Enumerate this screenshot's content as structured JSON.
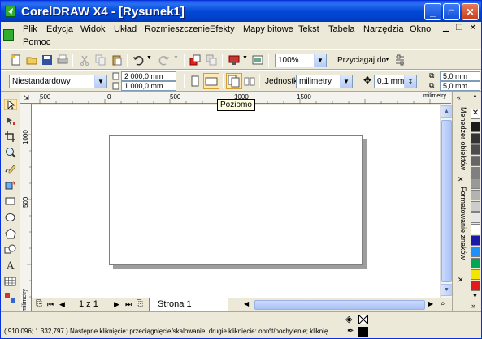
{
  "window": {
    "title": "CorelDRAW X4 - [Rysunek1]"
  },
  "menu": {
    "items": [
      "Plik",
      "Edycja",
      "Widok",
      "Układ",
      "Rozmieszczenie",
      "Efekty",
      "Mapy bitowe",
      "Tekst",
      "Tabela",
      "Narzędzia",
      "Okno",
      "Pomoc"
    ]
  },
  "standard_toolbar": {
    "zoom": "100%",
    "snap": "Przyciągaj do"
  },
  "property_bar": {
    "preset": "Niestandardowy",
    "width": "2 000,0 mm",
    "height": "1 000,0 mm",
    "units_label": "Jednostki:",
    "units": "milimetry",
    "nudge": "0,1 mm",
    "dup_x": "5,0 mm",
    "dup_y": "5,0 mm"
  },
  "tooltip": "Poziomo",
  "ruler": {
    "h_labels": [
      "500",
      "0",
      "500",
      "1000",
      "1500"
    ],
    "h_unit": "milimetry",
    "v_labels": [
      "1000",
      "500"
    ],
    "v_unit": "milimetry"
  },
  "docker": {
    "tabs": [
      "Menedżer obiektów",
      "Formatowanie znaków"
    ]
  },
  "palette": {
    "colors": [
      "#1a1a1a",
      "#333333",
      "#4d4d4d",
      "#666666",
      "#808080",
      "#999999",
      "#b3b3b3",
      "#cccccc",
      "#e6e6e6",
      "#ffffff",
      "#1a1aa6",
      "#1e90ff",
      "#00a651",
      "#f2e600",
      "#e31b1b"
    ]
  },
  "pages": {
    "counter": "1 z 1",
    "tab": "Strona 1"
  },
  "status": {
    "text": "( 910,096; 1 332,797 )  Następne kliknięcie: przeciągnięcie/skalowanie; drugie kliknięcie: obrót/pochylenie; kliknię..."
  }
}
